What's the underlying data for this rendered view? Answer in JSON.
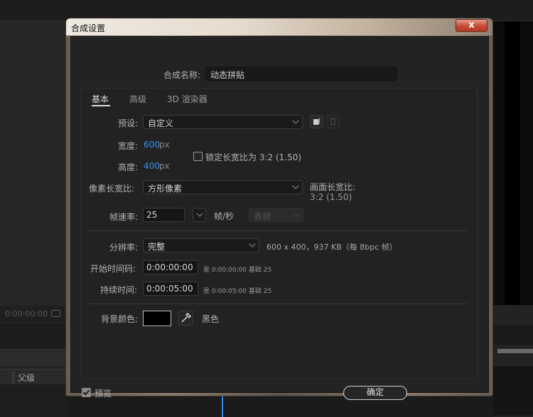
{
  "background": {
    "timecode": "0:00:00:00",
    "parent_column": "父级"
  },
  "dialog": {
    "title": "合成设置",
    "close_label": "x",
    "comp_name_label": "合成名称:",
    "comp_name_value": "动态拼贴",
    "tabs": [
      "基本",
      "高级",
      "3D 渲染器"
    ],
    "preset_label": "预设:",
    "preset_value": "自定义",
    "width_label": "宽度:",
    "width_value": "600",
    "height_label": "高度:",
    "height_value": "400",
    "px_unit": "px",
    "lock_aspect_label": "锁定长宽比为 3:2 (1.50)",
    "pixel_aspect_label": "像素长宽比:",
    "pixel_aspect_value": "方形像素",
    "frame_aspect_label": "画面长宽比:",
    "frame_aspect_value": "3:2 (1.50)",
    "frame_rate_label": "帧速率:",
    "frame_rate_value": "25",
    "fps_unit": "帧/秒",
    "drop_frame_value": "丢帧",
    "resolution_label": "分辨率:",
    "resolution_value": "完整",
    "resolution_info": "600 x 400，937 KB（每 8bpc 帧）",
    "start_tc_label": "开始时间码:",
    "start_tc_value": "0:00:00:00",
    "start_tc_note": "是 0:00:00:00  基础 25",
    "duration_label": "持续时间:",
    "duration_value": "0:00:05:00",
    "duration_note": "是 0:00:05:00  基础 25",
    "bg_color_label": "背景颜色:",
    "bg_color_name": "黑色",
    "bg_color_hex": "#000000",
    "preview_label": "预览",
    "ok_label": "确定"
  }
}
